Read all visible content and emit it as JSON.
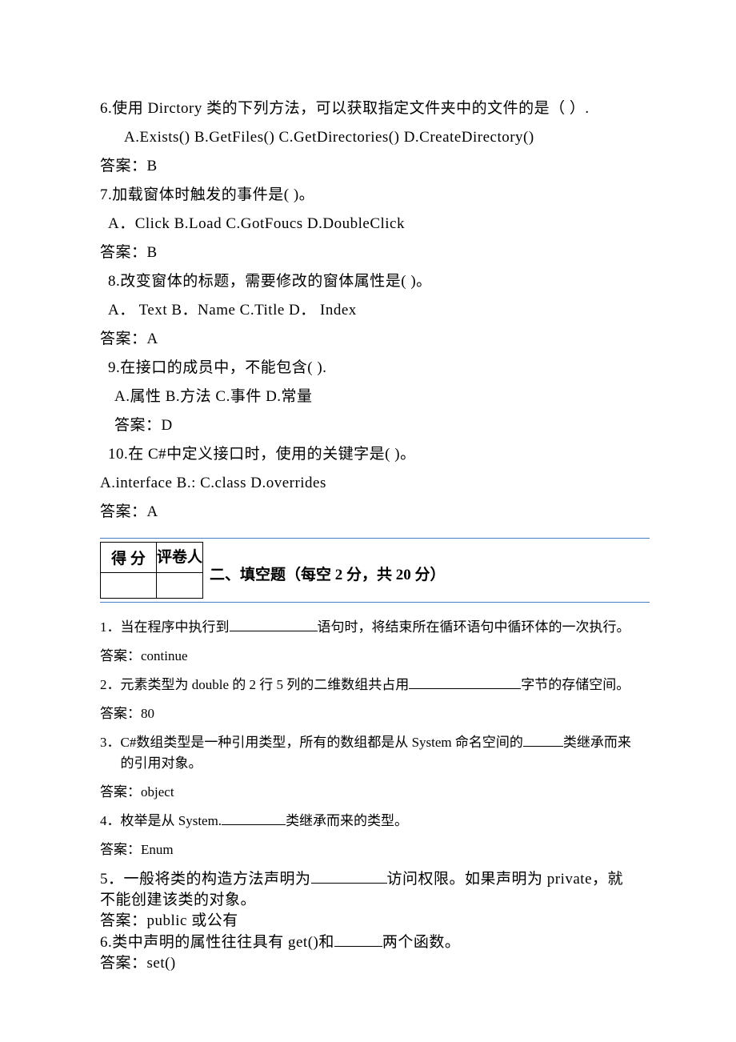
{
  "q6": {
    "text": "6.使用 Dirctory 类的下列方法，可以获取指定文件夹中的文件的是（    ）.",
    "opts": "A.Exists()    B.GetFiles()    C.GetDirectories()       D.CreateDirectory()",
    "ans": "答案：B"
  },
  "q7": {
    "text": "7.加载窗体时触发的事件是(       )。",
    "opts": "A．Click        B.Load     C.GotFoucs      D.DoubleClick",
    "ans": "答案：B"
  },
  "q8": {
    "text": "8.改变窗体的标题，需要修改的窗体属性是(        )。",
    "opts": "A．  Text      B．Name    C.Title      D．  Index",
    "ans": "答案：A"
  },
  "q9": {
    "text": "9.在接口的成员中，不能包含(     ).",
    "opts": "A.属性        B.方法     C.事件      D.常量",
    "ans": "答案：D"
  },
  "q10": {
    "text": "10.在 C#中定义接口时，使用的关键字是(        )。",
    "opts": "A.interface    B.:       C.class        D.overrides",
    "ans": "答案：A"
  },
  "scoreTable": {
    "score": "得 分",
    "grader": "评卷人"
  },
  "section2": {
    "title": "二、填空题（每空 2 分，共 20 分）"
  },
  "fill": {
    "f1": {
      "num": "1．",
      "pre": "当在程序中执行到",
      "post": "语句时，将结束所在循环语句中循环体的一次执行。",
      "ans": "答案：continue"
    },
    "f2": {
      "num": "2．",
      "pre": "元素类型为 double 的 2 行 5 列的二维数组共占用",
      "post": "字节的存储空间。",
      "ans": "答案：80"
    },
    "f3": {
      "num": "3．",
      "pre": "C#数组类型是一种引用类型，所有的数组都是从 System 命名空间的",
      "post1": "类继承而来",
      "post2": "的引用对象。",
      "ans": "答案：object"
    },
    "f4": {
      "num": "4．",
      "pre": "枚举是从 System.",
      "post": "类继承而来的类型。",
      "ans": "答案：Enum"
    },
    "f5": {
      "line1a": "5．一般将类的构造方法声明为",
      "line1b": "访问权限。如果声明为 private，就",
      "line2": "不能创建该类的对象。",
      "ans": "答案：public 或公有"
    },
    "f6": {
      "pre": "6.类中声明的属性往往具有 get()和",
      "post": "两个函数。",
      "ans": "答案：set()"
    }
  }
}
